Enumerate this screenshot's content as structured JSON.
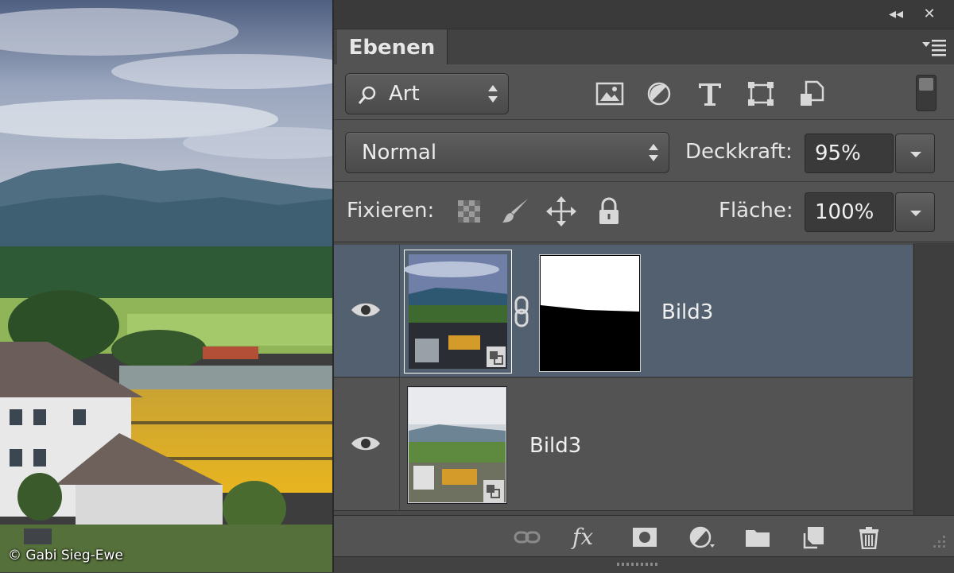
{
  "photo": {
    "credit": "© Gabi Sieg-Ewe"
  },
  "panel": {
    "topbar": {
      "collapse_glyph": "◂◂",
      "close_glyph": "✕"
    },
    "tab": {
      "label": "Ebenen"
    },
    "filter": {
      "kind_label": "Art",
      "icons": [
        "image-filter-icon",
        "adjustment-filter-icon",
        "type-filter-icon",
        "shape-filter-icon",
        "smart-object-filter-icon"
      ]
    },
    "blend": {
      "mode": "Normal",
      "opacity_label": "Deckkraft:",
      "opacity_value": "95%"
    },
    "lock": {
      "label": "Fixieren:",
      "icons": [
        "lock-transparent-pixels-icon",
        "lock-image-pixels-icon",
        "lock-position-icon",
        "lock-all-icon"
      ],
      "fill_label": "Fläche:",
      "fill_value": "100%"
    },
    "layers": [
      {
        "name": "Bild3",
        "selected": true,
        "visible": true,
        "has_mask": true
      },
      {
        "name": "Bild3",
        "selected": false,
        "visible": true,
        "has_mask": false
      }
    ],
    "bottom_icons": [
      "link-layers-icon",
      "fx-icon",
      "add-mask-icon",
      "new-adjustment-layer-icon",
      "new-group-icon",
      "new-layer-icon",
      "trash-icon"
    ],
    "fx_label": "fx",
    "colors": {
      "panel_bg": "#535353",
      "selected_layer": "#53606f",
      "field_bg": "#3a3a3a"
    }
  }
}
